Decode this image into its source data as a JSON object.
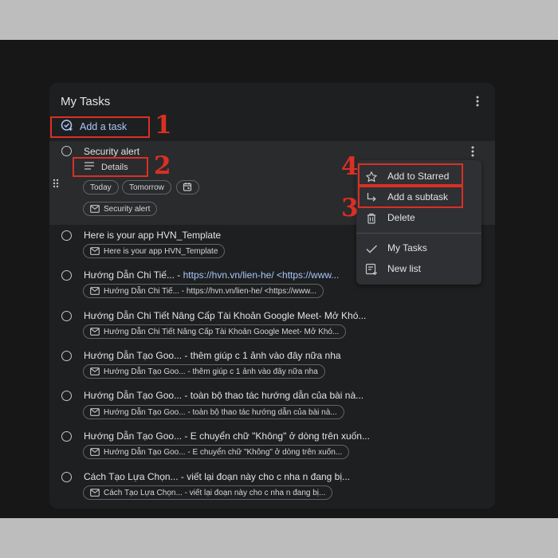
{
  "list_title": "My Tasks",
  "add_task_label": "Add a task",
  "annotations": [
    "1",
    "2",
    "3",
    "4"
  ],
  "selected_task": {
    "title": "Security alert",
    "details_label": "Details",
    "chips": [
      "Today",
      "Tomorrow"
    ],
    "source_chip": "Security alert"
  },
  "tasks": [
    {
      "title": "Here is your app HVN_Template",
      "title_link": "",
      "chip": "Here is your app HVN_Template"
    },
    {
      "title": "Hướng Dẫn Chi Tiế... - ",
      "title_link": "https://hvn.vn/lien-he/  <https://www...",
      "chip": "Hướng Dẫn Chi Tiế... - https://hvn.vn/lien-he/ <https://www..."
    },
    {
      "title": "Hướng Dẫn Chi Tiết Nâng Cấp Tài Khoản Google Meet- Mở Khó...",
      "title_link": "",
      "chip": "Hướng Dẫn Chi Tiết Nâng Cấp Tài Khoản Google Meet- Mở Khó..."
    },
    {
      "title": "Hướng Dẫn Tạo Goo... - thêm giúp c 1 ảnh vào đây nữa nha",
      "title_link": "",
      "chip": "Hướng Dẫn Tạo Goo... - thêm giúp c 1 ảnh vào đây nữa nha"
    },
    {
      "title": "Hướng Dẫn Tạo Goo... - toàn bộ thao tác hướng dẫn của bài nà...",
      "title_link": "",
      "chip": "Hướng Dẫn Tạo Goo... - toàn bộ thao tác hướng dẫn của bài nà..."
    },
    {
      "title": "Hướng Dẫn Tạo Goo... - E chuyển chữ \"Không\" ở dòng trên xuốn...",
      "title_link": "",
      "chip": "Hướng Dẫn Tạo Goo... - E chuyển chữ \"Không\" ở dòng trên xuốn..."
    },
    {
      "title": "Cách Tạo Lựa Chọn... - viết lại đoạn này cho c nha n đang bị...",
      "title_link": "",
      "chip": "Cách Tạo Lựa Chọn... - viết lại đoạn này cho c nha n đang bị..."
    }
  ],
  "menu": {
    "items": [
      "Add to Starred",
      "Add a subtask",
      "Delete",
      "My Tasks",
      "New list"
    ]
  },
  "colors": {
    "accent": "#a8c7fa",
    "annotation": "#d93025",
    "background": "#1e1f20"
  }
}
